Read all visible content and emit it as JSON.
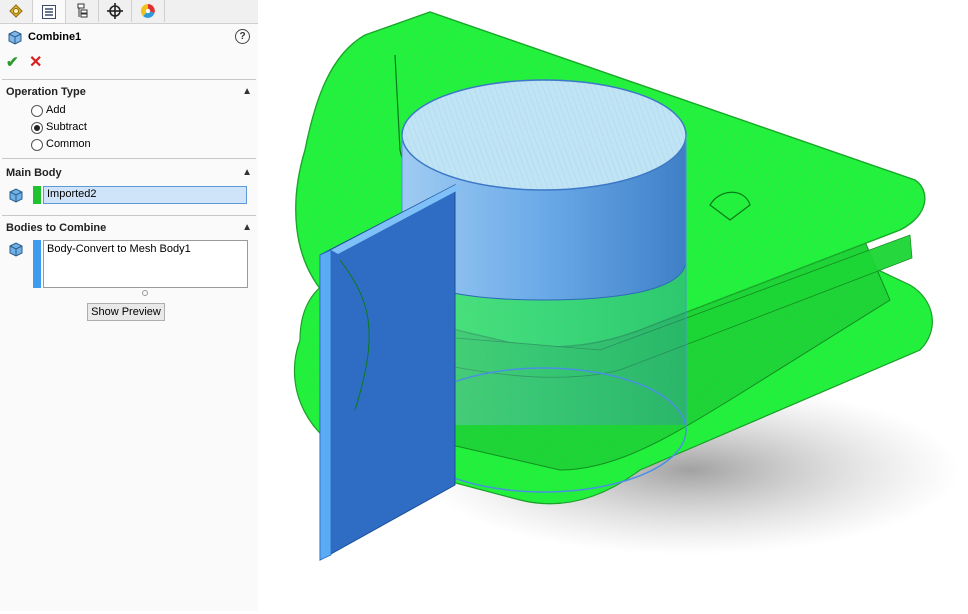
{
  "feature": {
    "title": "Combine1",
    "help_icon": "help-icon",
    "ok_icon": "checkmark-icon",
    "cancel_icon": "close-icon"
  },
  "tabs": [
    {
      "icon": "feature-manager-icon"
    },
    {
      "icon": "property-manager-icon",
      "active": true
    },
    {
      "icon": "configuration-manager-icon"
    },
    {
      "icon": "dimxpert-manager-icon"
    },
    {
      "icon": "display-manager-icon"
    }
  ],
  "operation_type": {
    "title": "Operation Type",
    "options": [
      {
        "label": "Add",
        "selected": false
      },
      {
        "label": "Subtract",
        "selected": true
      },
      {
        "label": "Common",
        "selected": false
      }
    ]
  },
  "main_body": {
    "title": "Main Body",
    "value": "Imported2",
    "color": "#1fc32f"
  },
  "bodies_to_combine": {
    "title": "Bodies to Combine",
    "items": [
      "Body-Convert to Mesh Body1"
    ],
    "color": "#3c9cf0"
  },
  "buttons": {
    "show_preview": "Show Preview"
  },
  "colors": {
    "main_body_green": "#20f13a",
    "tool_body_blue": "#5aaaf5",
    "plate_blue": "#2f6dc4"
  }
}
